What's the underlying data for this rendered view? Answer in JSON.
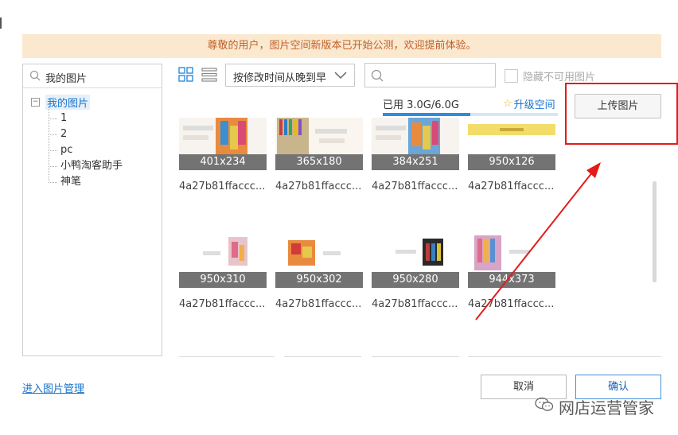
{
  "notice": "尊敬的用户，图片空间新版本已开始公测，欢迎提前体验。",
  "tree": {
    "search_placeholder": "我的图片",
    "root_label": "我的图片",
    "root_toggle": "−",
    "children": [
      "1",
      "2",
      "pc",
      "小鸭淘客助手",
      "神笔"
    ]
  },
  "toolbar": {
    "sort_label": "按修改时间从晚到早",
    "search_value": "",
    "hide_unavailable_label": "隐藏不可用图片",
    "hide_unavailable_checked": false,
    "usage_label": "已用 3.0G/6.0G",
    "usage_fraction": 0.5,
    "upgrade_label": "升级空间",
    "upgrade_star": "☆",
    "upload_label": "上传图片"
  },
  "images": [
    {
      "dim": "401x234",
      "name": "4a27b81ffaccc..."
    },
    {
      "dim": "365x180",
      "name": "4a27b81ffaccc..."
    },
    {
      "dim": "384x251",
      "name": "4a27b81ffaccc..."
    },
    {
      "dim": "950x126",
      "name": "4a27b81ffaccc..."
    },
    {
      "dim": "950x310",
      "name": "4a27b81ffaccc..."
    },
    {
      "dim": "950x302",
      "name": "4a27b81ffaccc..."
    },
    {
      "dim": "950x280",
      "name": "4a27b81ffaccc..."
    },
    {
      "dim": "944x373",
      "name": "4a27b81ffaccc..."
    }
  ],
  "footer": {
    "manage_link": "进入图片管理",
    "cancel_label": "取消",
    "ok_label": "确认"
  },
  "watermark": "网店运营管家",
  "colors": {
    "accent_blue": "#1a73c9",
    "annotation_red": "#e41b1b",
    "notice_bg": "#fbe9cf",
    "notice_text": "#c0602a"
  }
}
